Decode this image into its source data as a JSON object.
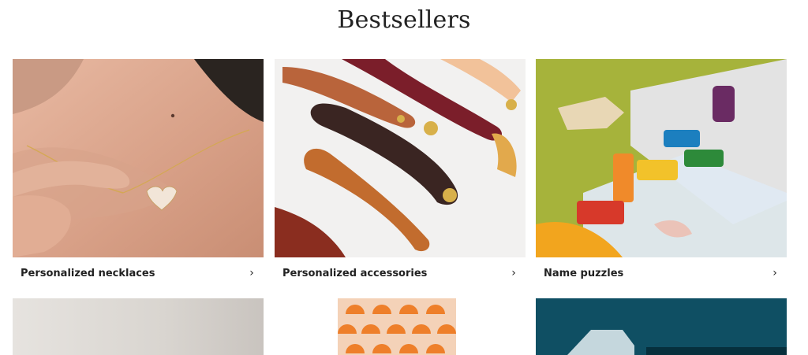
{
  "page": {
    "title": "Bestsellers"
  },
  "cards": [
    {
      "label": "Personalized necklaces",
      "chevron": "›"
    },
    {
      "label": "Personalized accessories",
      "chevron": "›"
    },
    {
      "label": "Name puzzles",
      "chevron": "›"
    }
  ],
  "colors": {
    "title": "#222222",
    "label": "#222222",
    "background": "#ffffff"
  }
}
